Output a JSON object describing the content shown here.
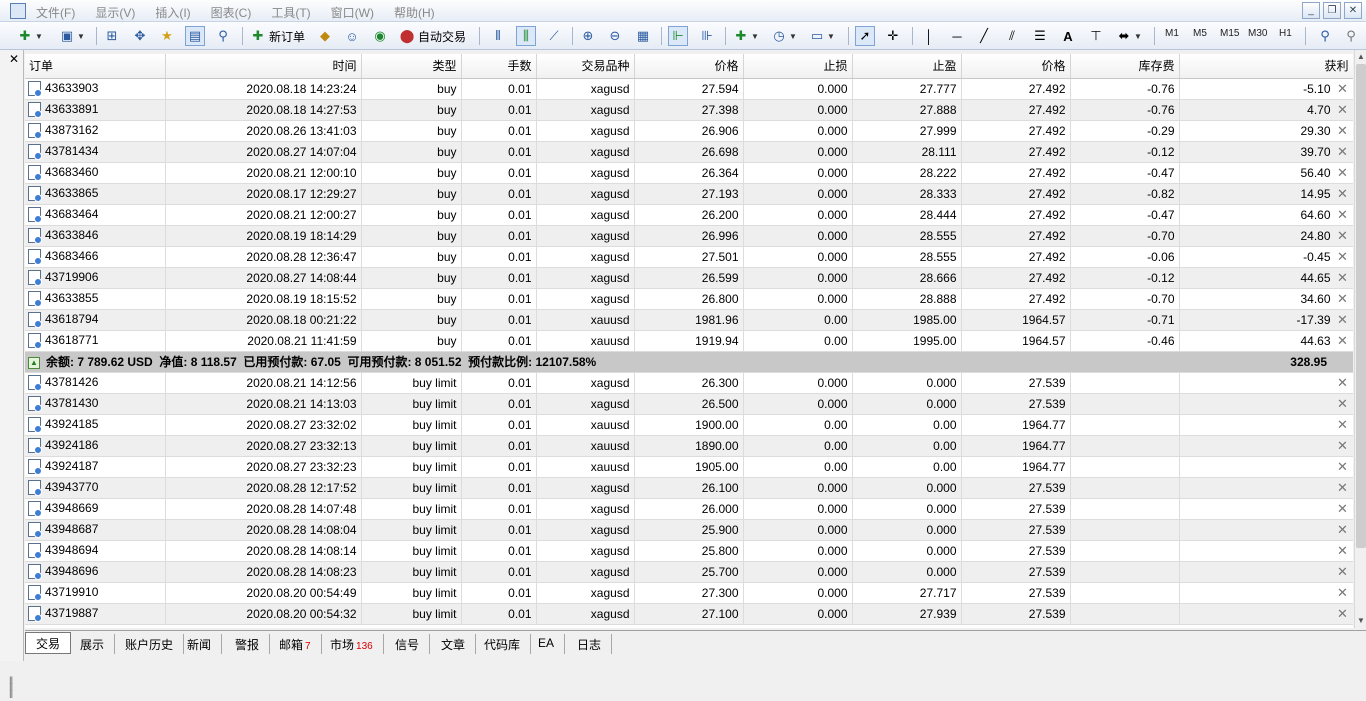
{
  "menu": [
    "文件(F)",
    "显示(V)",
    "插入(I)",
    "图表(C)",
    "工具(T)",
    "窗口(W)",
    "帮助(H)"
  ],
  "toolbar": {
    "new_order": "新订单",
    "auto_trade": "自动交易",
    "timeframes": [
      "M1",
      "M5",
      "M15",
      "M30",
      "H1"
    ]
  },
  "columns": [
    "订单",
    "时间",
    "类型",
    "手数",
    "交易品种",
    "价格",
    "止损",
    "止盈",
    "价格",
    "库存费",
    "获利"
  ],
  "open_positions": [
    [
      "43633903",
      "2020.08.18 14:23:24",
      "buy",
      "0.01",
      "xagusd",
      "27.594",
      "0.000",
      "27.777",
      "27.492",
      "-0.76",
      "-5.10"
    ],
    [
      "43633891",
      "2020.08.18 14:27:53",
      "buy",
      "0.01",
      "xagusd",
      "27.398",
      "0.000",
      "27.888",
      "27.492",
      "-0.76",
      "4.70"
    ],
    [
      "43873162",
      "2020.08.26 13:41:03",
      "buy",
      "0.01",
      "xagusd",
      "26.906",
      "0.000",
      "27.999",
      "27.492",
      "-0.29",
      "29.30"
    ],
    [
      "43781434",
      "2020.08.27 14:07:04",
      "buy",
      "0.01",
      "xagusd",
      "26.698",
      "0.000",
      "28.111",
      "27.492",
      "-0.12",
      "39.70"
    ],
    [
      "43683460",
      "2020.08.21 12:00:10",
      "buy",
      "0.01",
      "xagusd",
      "26.364",
      "0.000",
      "28.222",
      "27.492",
      "-0.47",
      "56.40"
    ],
    [
      "43633865",
      "2020.08.17 12:29:27",
      "buy",
      "0.01",
      "xagusd",
      "27.193",
      "0.000",
      "28.333",
      "27.492",
      "-0.82",
      "14.95"
    ],
    [
      "43683464",
      "2020.08.21 12:00:27",
      "buy",
      "0.01",
      "xagusd",
      "26.200",
      "0.000",
      "28.444",
      "27.492",
      "-0.47",
      "64.60"
    ],
    [
      "43633846",
      "2020.08.19 18:14:29",
      "buy",
      "0.01",
      "xagusd",
      "26.996",
      "0.000",
      "28.555",
      "27.492",
      "-0.70",
      "24.80"
    ],
    [
      "43683466",
      "2020.08.28 12:36:47",
      "buy",
      "0.01",
      "xagusd",
      "27.501",
      "0.000",
      "28.555",
      "27.492",
      "-0.06",
      "-0.45"
    ],
    [
      "43719906",
      "2020.08.27 14:08:44",
      "buy",
      "0.01",
      "xagusd",
      "26.599",
      "0.000",
      "28.666",
      "27.492",
      "-0.12",
      "44.65"
    ],
    [
      "43633855",
      "2020.08.19 18:15:52",
      "buy",
      "0.01",
      "xagusd",
      "26.800",
      "0.000",
      "28.888",
      "27.492",
      "-0.70",
      "34.60"
    ],
    [
      "43618794",
      "2020.08.18 00:21:22",
      "buy",
      "0.01",
      "xauusd",
      "1981.96",
      "0.00",
      "1985.00",
      "1964.57",
      "-0.71",
      "-17.39"
    ],
    [
      "43618771",
      "2020.08.21 11:41:59",
      "buy",
      "0.01",
      "xauusd",
      "1919.94",
      "0.00",
      "1995.00",
      "1964.57",
      "-0.46",
      "44.63"
    ]
  ],
  "summary": {
    "text": "余额: 7 789.62 USD  净值: 8 118.57  已用预付款: 67.05  可用预付款: 8 051.52  预付款比例: 12107.58%",
    "profit": "328.95"
  },
  "pending_orders": [
    [
      "43781426",
      "2020.08.21 14:12:56",
      "buy limit",
      "0.01",
      "xagusd",
      "26.300",
      "0.000",
      "0.000",
      "27.539",
      "",
      ""
    ],
    [
      "43781430",
      "2020.08.21 14:13:03",
      "buy limit",
      "0.01",
      "xagusd",
      "26.500",
      "0.000",
      "0.000",
      "27.539",
      "",
      ""
    ],
    [
      "43924185",
      "2020.08.27 23:32:02",
      "buy limit",
      "0.01",
      "xauusd",
      "1900.00",
      "0.00",
      "0.00",
      "1964.77",
      "",
      ""
    ],
    [
      "43924186",
      "2020.08.27 23:32:13",
      "buy limit",
      "0.01",
      "xauusd",
      "1890.00",
      "0.00",
      "0.00",
      "1964.77",
      "",
      ""
    ],
    [
      "43924187",
      "2020.08.27 23:32:23",
      "buy limit",
      "0.01",
      "xauusd",
      "1905.00",
      "0.00",
      "0.00",
      "1964.77",
      "",
      ""
    ],
    [
      "43943770",
      "2020.08.28 12:17:52",
      "buy limit",
      "0.01",
      "xagusd",
      "26.100",
      "0.000",
      "0.000",
      "27.539",
      "",
      ""
    ],
    [
      "43948669",
      "2020.08.28 14:07:48",
      "buy limit",
      "0.01",
      "xagusd",
      "26.000",
      "0.000",
      "0.000",
      "27.539",
      "",
      ""
    ],
    [
      "43948687",
      "2020.08.28 14:08:04",
      "buy limit",
      "0.01",
      "xagusd",
      "25.900",
      "0.000",
      "0.000",
      "27.539",
      "",
      ""
    ],
    [
      "43948694",
      "2020.08.28 14:08:14",
      "buy limit",
      "0.01",
      "xagusd",
      "25.800",
      "0.000",
      "0.000",
      "27.539",
      "",
      ""
    ],
    [
      "43948696",
      "2020.08.28 14:08:23",
      "buy limit",
      "0.01",
      "xagusd",
      "25.700",
      "0.000",
      "0.000",
      "27.539",
      "",
      ""
    ],
    [
      "43719910",
      "2020.08.20 00:54:49",
      "buy limit",
      "0.01",
      "xagusd",
      "27.300",
      "0.000",
      "27.717",
      "27.539",
      "",
      ""
    ],
    [
      "43719887",
      "2020.08.20 00:54:32",
      "buy limit",
      "0.01",
      "xagusd",
      "27.100",
      "0.000",
      "27.939",
      "27.539",
      "",
      ""
    ]
  ],
  "tabs": [
    {
      "label": "交易",
      "badge": ""
    },
    {
      "label": "展示",
      "badge": ""
    },
    {
      "label": "账户历史",
      "badge": ""
    },
    {
      "label": "新闻",
      "badge": ""
    },
    {
      "label": "警报",
      "badge": ""
    },
    {
      "label": "邮箱",
      "badge": "7"
    },
    {
      "label": "市场",
      "badge": "136"
    },
    {
      "label": "信号",
      "badge": ""
    },
    {
      "label": "文章",
      "badge": ""
    },
    {
      "label": "代码库",
      "badge": ""
    },
    {
      "label": "EA",
      "badge": ""
    },
    {
      "label": "日志",
      "badge": ""
    }
  ]
}
